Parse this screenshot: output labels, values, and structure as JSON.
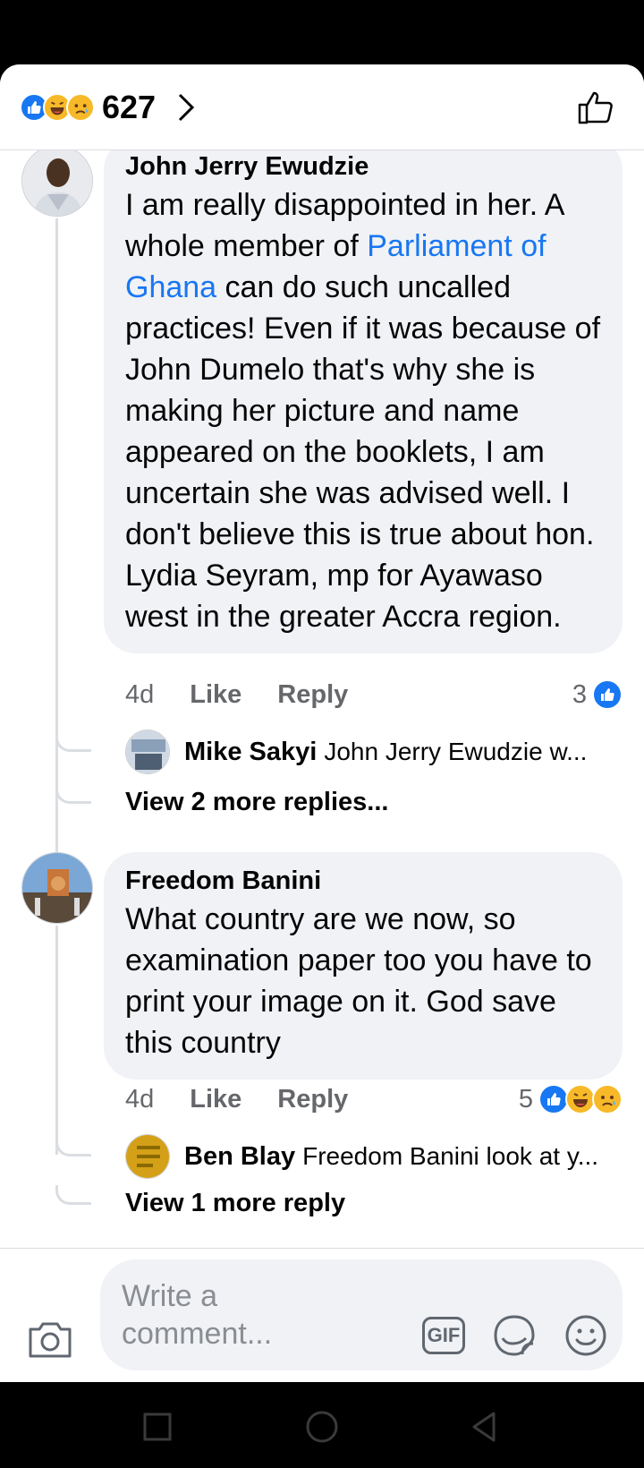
{
  "header": {
    "reaction_icons": [
      "like-icon",
      "haha-icon",
      "sad-icon"
    ],
    "reaction_count": "627"
  },
  "comments": [
    {
      "author": "John Jerry Ewudzie",
      "text_before_link": "I am really disappointed in her. A whole member of ",
      "link_text": "Parliament of Ghana",
      "text_after_link": " can do such uncalled practices! Even if it was because of John Dumelo that's why she is making her picture and name appeared on the booklets, I am uncertain she was advised well. I don't believe this is true about hon. Lydia Seyram, mp for Ayawaso west in the greater Accra region.",
      "age": "4d",
      "like_label": "Like",
      "reply_label": "Reply",
      "reaction_count": "3",
      "reaction_icons": [
        "like-icon"
      ],
      "preview_reply": {
        "author": "Mike Sakyi",
        "text": "John Jerry Ewudzie w..."
      },
      "view_more": "View 2 more replies..."
    },
    {
      "author": "Freedom Banini",
      "text": "What country are we now, so examination paper too you have to print your image on it. God save this country",
      "age": "4d",
      "like_label": "Like",
      "reply_label": "Reply",
      "reaction_count": "5",
      "reaction_icons": [
        "like-icon",
        "haha-icon",
        "sad-icon"
      ],
      "preview_reply": {
        "author": "Ben Blay",
        "text": "Freedom Banini look at y..."
      },
      "view_more": "View 1 more reply"
    }
  ],
  "composer": {
    "placeholder": "Write a comment...",
    "gif_label": "GIF"
  },
  "colors": {
    "accent": "#1877f2",
    "bubble": "#f0f2f5",
    "secondary_text": "#65676b",
    "haha_sad": "#f7b928"
  },
  "nav": [
    "recents-square-icon",
    "home-circle-icon",
    "back-triangle-icon"
  ]
}
